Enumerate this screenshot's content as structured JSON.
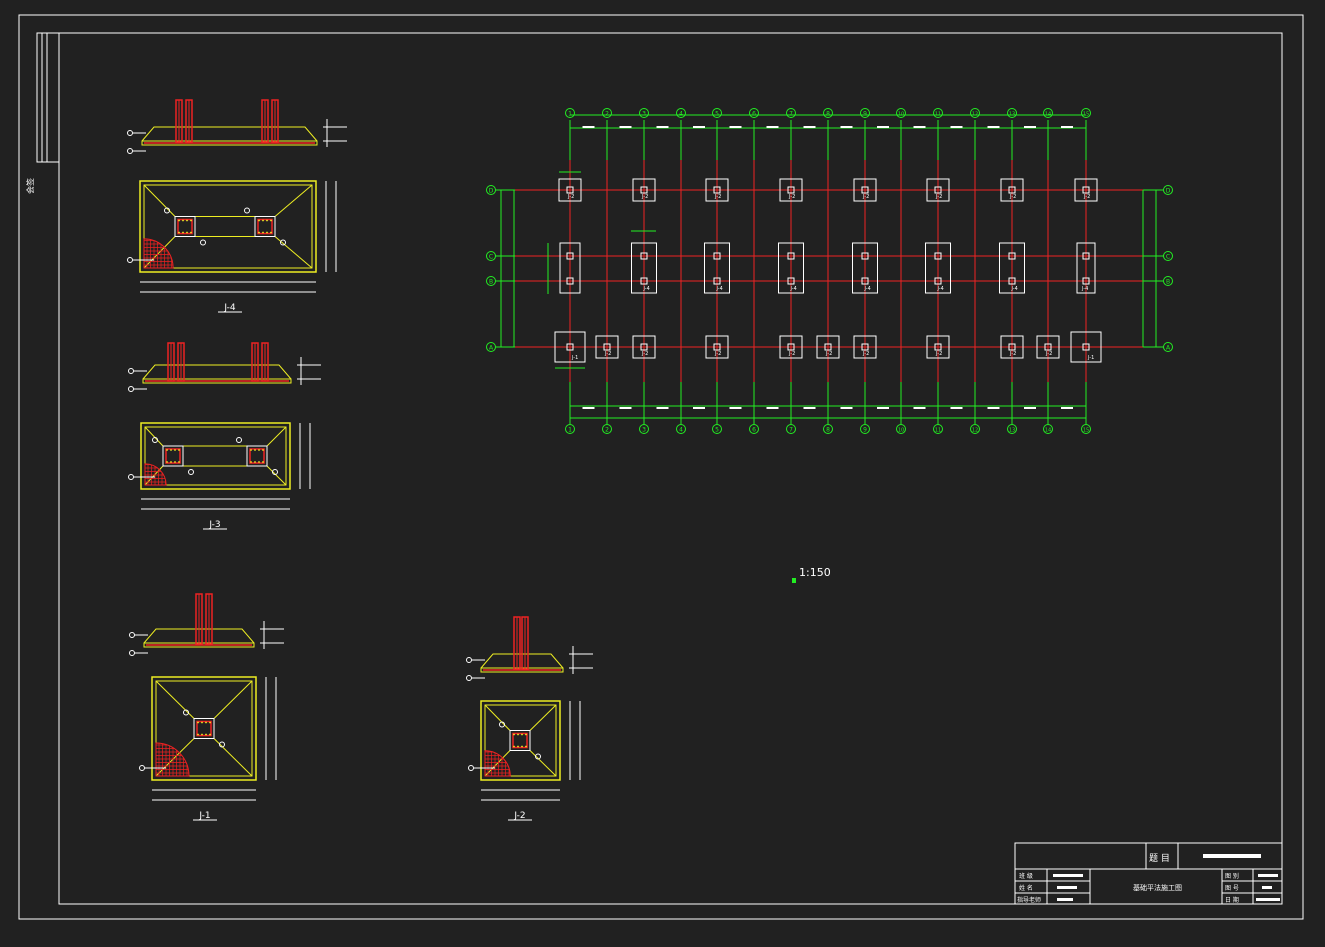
{
  "drawing": {
    "side_label": "会签",
    "scale": "1:150",
    "plan": {
      "axes_top": [
        "1",
        "2",
        "3",
        "4",
        "5",
        "6",
        "7",
        "8",
        "9",
        "10",
        "11",
        "12",
        "13",
        "14",
        "15"
      ],
      "axes_bottom": [
        "1",
        "2",
        "3",
        "4",
        "5",
        "6",
        "7",
        "8",
        "9",
        "10",
        "11",
        "12",
        "13",
        "14",
        "15"
      ],
      "axes_side": [
        "D",
        "C",
        "B",
        "A"
      ],
      "footing_tags_row_D": [
        "J-2",
        "J-2",
        "J-2",
        "J-2",
        "J-2",
        "J-2",
        "J-2",
        "J-2"
      ],
      "footing_tags_row_BC": [
        "J-4",
        "J-4",
        "J-4",
        "J-4",
        "J-4",
        "J-4",
        "J-4"
      ],
      "footing_tags_row_A": [
        "J-1",
        "J-2",
        "J-2",
        "J-2",
        "J-2",
        "J-2",
        "J-2",
        "J-2",
        "J-2",
        "J-2",
        "J-1"
      ]
    },
    "details": [
      {
        "label": "J-4"
      },
      {
        "label": "J-3"
      },
      {
        "label": "J-1"
      },
      {
        "label": "J-2"
      }
    ],
    "title_block": {
      "heading": "题  目",
      "drawing_name": "基础平法施工图",
      "left_rows": [
        "班 级",
        "姓 名",
        "指导老师"
      ],
      "right_rows": [
        "图 别",
        "图 号",
        "日 期"
      ]
    }
  }
}
